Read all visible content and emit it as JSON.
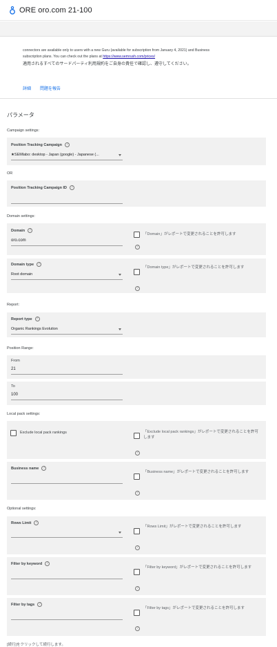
{
  "header": {
    "title": "ORE oro.com 21-100"
  },
  "notice": {
    "line1": "connectors are available only to users with a new Guru (available for subscription from January 4, 2021) and Business",
    "line2_prefix": "subscription plans. You can check out the plans at ",
    "line2_link": "https://www.semrush.com/prices/",
    "japanese": "適用されるすべてのサードパーティ利用規約をご自身の責任で確認し、遵守してください。"
  },
  "links": {
    "details": "詳細",
    "report_issue": "問題を報告"
  },
  "page": {
    "heading": "パラメータ",
    "bottom_note": "[続行]をクリックして続行します。"
  },
  "sections": {
    "campaign": "Campaign settings:",
    "or": "OR",
    "domain": "Domain settings:",
    "report": "Report:",
    "position_range": "Position Range:",
    "local_pack": "Local pack settings:",
    "optional": "Optional settings:"
  },
  "fields": {
    "campaign": {
      "label": "Position Tracking Campaign",
      "value": "★SEMlabo: desktop - Japan (google) - Japanese (..."
    },
    "campaign_id": {
      "label": "Position Tracking Campaign ID",
      "value": ""
    },
    "domain": {
      "label": "Domain",
      "value": "oro.com",
      "allow_text": "「Domain」がレポートで変更されることを許可します"
    },
    "domain_type": {
      "label": "Domain type",
      "value": "Root domain",
      "allow_text": "「Domain type」がレポートで変更されることを許可します"
    },
    "report_type": {
      "label": "Report type",
      "value": "Organic Rankings Evolution"
    },
    "from": {
      "label": "From",
      "value": "21"
    },
    "to": {
      "label": "To",
      "value": "100"
    },
    "exclude_local": {
      "label": "Exclude local pack rankings",
      "allow_text": "「Exclude local pack rankings」がレポートで変更されることを許可します"
    },
    "business_name": {
      "label": "Business name",
      "value": "",
      "allow_text": "「Business name」がレポートで変更されることを許可します"
    },
    "rows_limit": {
      "label": "Rows Limit",
      "value": "",
      "allow_text": "「Rows Limit」がレポートで変更されることを許可します"
    },
    "filter_keyword": {
      "label": "Filter by keyword",
      "value": "",
      "allow_text": "「Filter by keyword」がレポートで変更されることを許可します"
    },
    "filter_tags": {
      "label": "Filter by tags",
      "value": "",
      "allow_text": "「Filter by tags」がレポートで変更されることを許可します"
    }
  },
  "icons": {
    "logo": "data-studio-logo-icon",
    "help": "help-circle-icon",
    "dropdown": "dropdown-caret-icon"
  }
}
